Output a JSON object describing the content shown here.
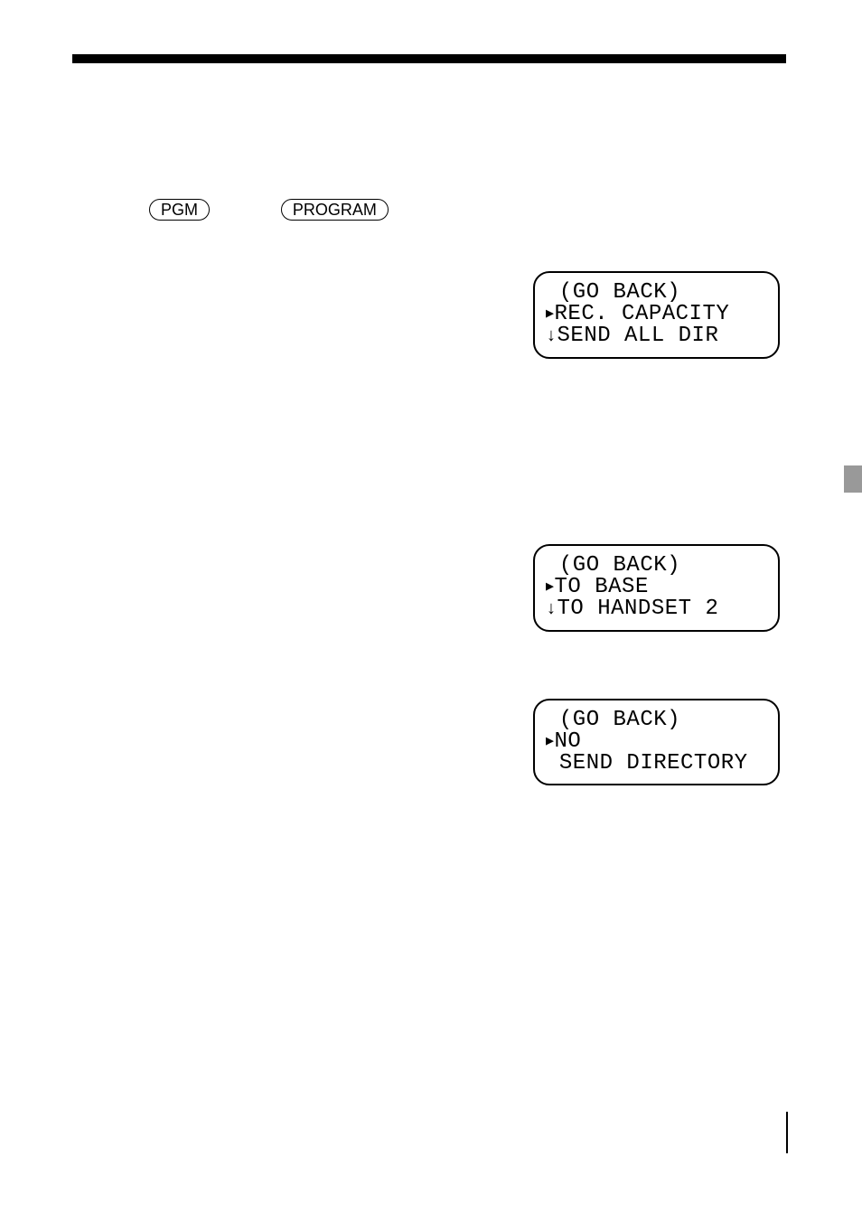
{
  "buttons": {
    "pgm": "PGM",
    "program": "PROGRAM"
  },
  "lcd1": {
    "line1": "(GO BACK)",
    "line2": "REC. CAPACITY",
    "line3": "SEND ALL DIR"
  },
  "lcd2": {
    "line1": "(GO BACK)",
    "line2": "TO BASE",
    "line3": "TO HANDSET 2"
  },
  "lcd3": {
    "line1": "(GO BACK)",
    "line2": "NO",
    "line3": "SEND DIRECTORY"
  }
}
